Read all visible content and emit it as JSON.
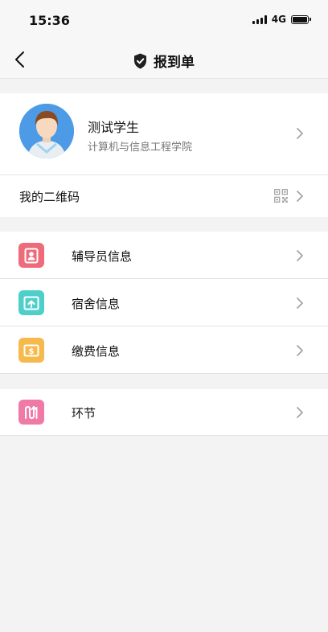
{
  "status_bar": {
    "time": "15:36",
    "network": "4G"
  },
  "nav": {
    "title": "报到单"
  },
  "profile": {
    "name": "测试学生",
    "college": "计算机与信息工程学院"
  },
  "qr": {
    "label": "我的二维码"
  },
  "menu": [
    {
      "label": "辅导员信息",
      "icon": "counselor-badge-icon",
      "color": "#ee6b7a"
    },
    {
      "label": "宿舍信息",
      "icon": "dormitory-icon",
      "color": "#4fcfc9"
    },
    {
      "label": "缴费信息",
      "icon": "payment-icon",
      "color": "#f6b94b"
    }
  ],
  "process": {
    "label": "环节",
    "icon": "process-flow-icon",
    "color": "#f07aa6"
  },
  "colors": {
    "background": "#f3f3f3",
    "card": "#ffffff"
  }
}
